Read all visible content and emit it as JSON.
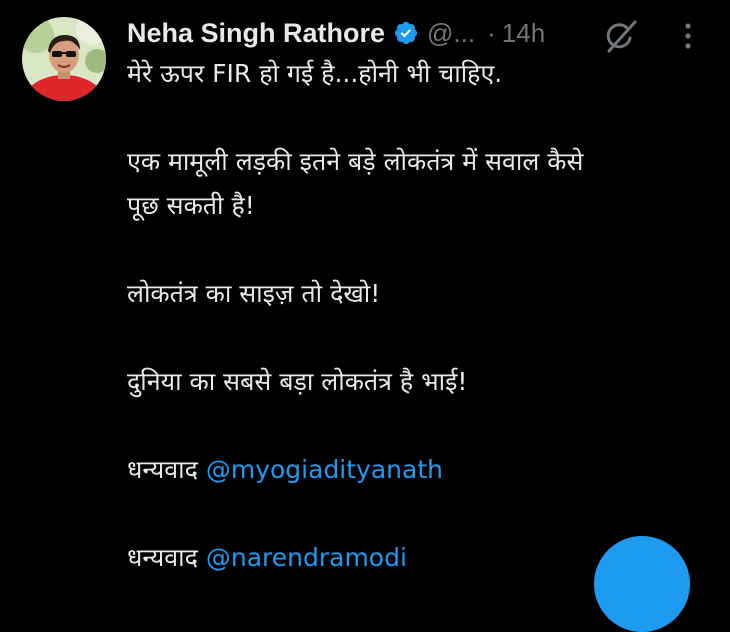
{
  "author": {
    "name": "Neha Singh Rathore",
    "handle": "@...",
    "separator": "·",
    "time": "14h",
    "verified_icon": "verified-badge-icon"
  },
  "icons": {
    "grok": "grok-icon",
    "more": "more-vertical-icon"
  },
  "colors": {
    "background": "#000000",
    "text": "#e7e9ea",
    "muted": "#71767b",
    "accent": "#1d9bf0"
  },
  "tweet": {
    "line1": "मेरे ऊपर FIR हो गई है...होनी भी चाहिए.",
    "line2": "एक मामूली लड़की इतने बड़े लोकतंत्र में सवाल कैसे",
    "line3": "पूछ सकती है!",
    "line4": "लोकतंत्र का साइज़ तो देखो!",
    "line5": "दुनिया का सबसे बड़ा लोकतंत्र है भाई!",
    "thanks1_prefix": "धन्यवाद ",
    "thanks1_mention": "@myogiadityanath",
    "thanks2_prefix": "धन्यवाद ",
    "thanks2_mention": "@narendramodi"
  }
}
